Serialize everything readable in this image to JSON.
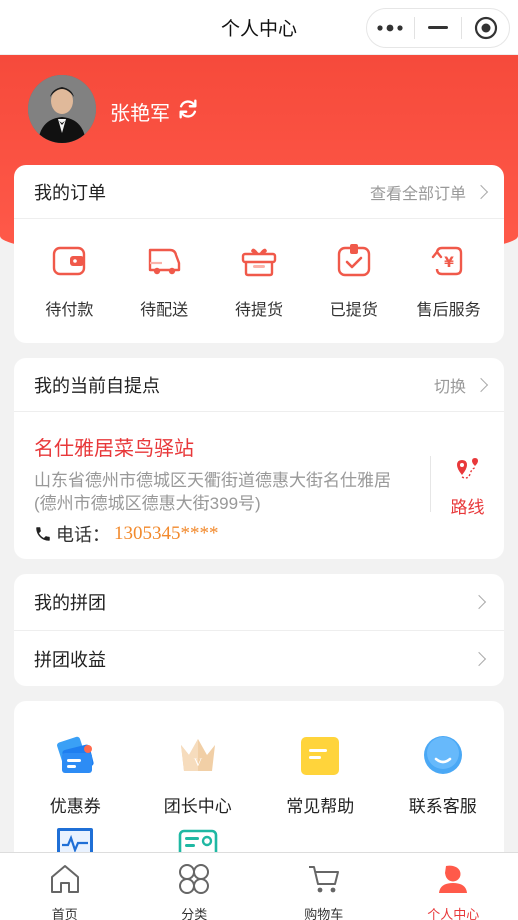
{
  "nav": {
    "title": "个人中心"
  },
  "profile": {
    "username": "张艳军"
  },
  "orders": {
    "title": "我的订单",
    "view_all": "查看全部订单",
    "items": [
      {
        "label": "待付款",
        "icon": "wallet-icon"
      },
      {
        "label": "待配送",
        "icon": "truck-icon"
      },
      {
        "label": "待提货",
        "icon": "gift-box-icon"
      },
      {
        "label": "已提货",
        "icon": "checked-box-icon"
      },
      {
        "label": "售后服务",
        "icon": "refund-icon"
      }
    ]
  },
  "pickup": {
    "title": "我的当前自提点",
    "switch_label": "切换",
    "station_name": "名仕雅居菜鸟驿站",
    "address": "山东省德州市德城区天衢街道德惠大街名仕雅居(德州市德城区德惠大街399号)",
    "phone_label": "电话：",
    "phone": "1305345****",
    "route_label": "路线"
  },
  "group": {
    "rows": [
      {
        "label": "我的拼团"
      },
      {
        "label": "拼团收益"
      }
    ]
  },
  "services": {
    "items": [
      {
        "label": "优惠券",
        "icon": "coupon-icon"
      },
      {
        "label": "团长中心",
        "icon": "crown-icon"
      },
      {
        "label": "常见帮助",
        "icon": "help-note-icon"
      },
      {
        "label": "联系客服",
        "icon": "chat-bubble-icon"
      },
      {
        "label": "",
        "icon": "monitor-icon"
      },
      {
        "label": "",
        "icon": "id-card-icon"
      }
    ]
  },
  "tabbar": {
    "items": [
      {
        "label": "首页",
        "icon": "home-icon"
      },
      {
        "label": "分类",
        "icon": "category-icon"
      },
      {
        "label": "购物车",
        "icon": "cart-icon"
      },
      {
        "label": "个人中心",
        "icon": "user-icon",
        "active": true
      }
    ]
  },
  "colors": {
    "brand_red": "#e8383a",
    "header_red": "#f64a3b",
    "phone_orange": "#f28a2d"
  }
}
